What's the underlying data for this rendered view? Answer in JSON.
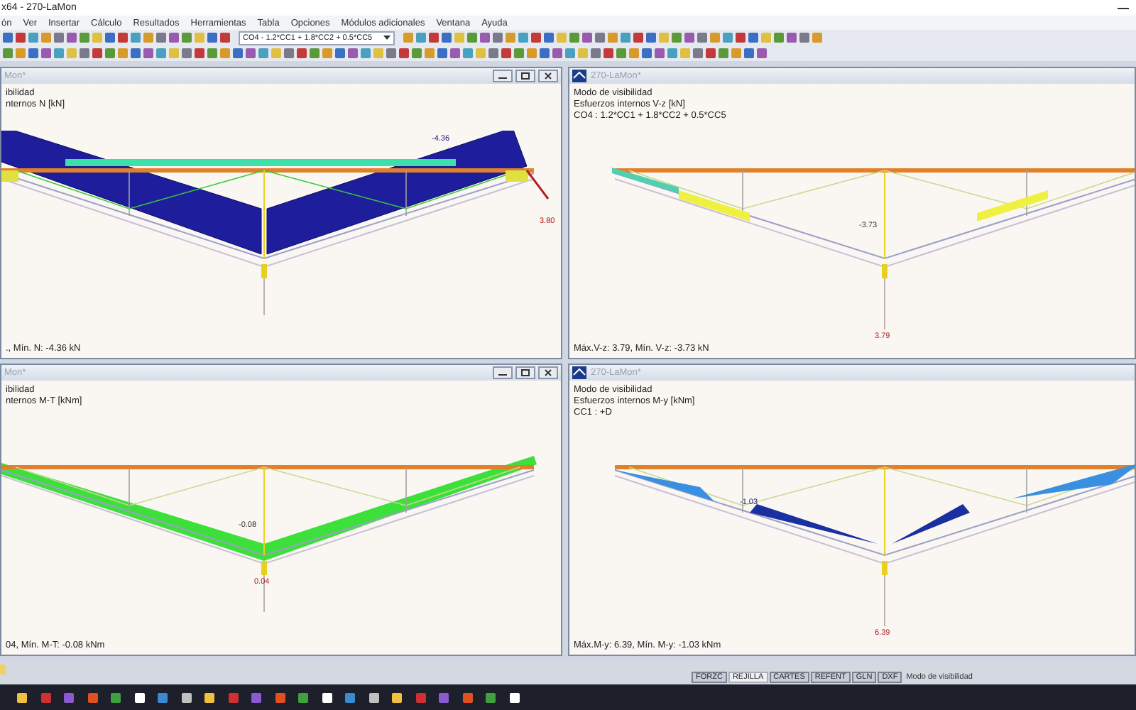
{
  "window": {
    "title": "x64 - 270-LaMon"
  },
  "menu": [
    "ón",
    "Ver",
    "Insertar",
    "Cálculo",
    "Resultados",
    "Herramientas",
    "Tabla",
    "Opciones",
    "Módulos adicionales",
    "Ventana",
    "Ayuda"
  ],
  "toolbar": {
    "load_combination": "CO4 - 1.2*CC1 + 1.8*CC2 + 0.5*CC5"
  },
  "panels": [
    {
      "title": "Mon*",
      "window_buttons": true,
      "app_icon": false,
      "kind": "axial",
      "info_lines": [
        "ibilidad",
        "nternos N [kN]"
      ],
      "labels": [
        "-4.36",
        "3.80"
      ],
      "summary": "., Mín. N: -4.36 kN"
    },
    {
      "title": "270-LaMon*",
      "window_buttons": false,
      "app_icon": true,
      "kind": "shear",
      "info_lines": [
        "Modo de visibilidad",
        "Esfuerzos internos V-z [kN]",
        "CO4 : 1.2*CC1 + 1.8*CC2 + 0.5*CC5"
      ],
      "labels": [
        "-3.73",
        "3.79"
      ],
      "summary": "Máx.V-z: 3.79, Mín. V-z: -3.73 kN"
    },
    {
      "title": "Mon*",
      "window_buttons": true,
      "app_icon": false,
      "kind": "torsion",
      "info_lines": [
        "ibilidad",
        "nternos M-T [kNm]"
      ],
      "labels": [
        "-0.08",
        "0.04"
      ],
      "summary": "04, Mín. M-T: -0.08 kNm"
    },
    {
      "title": "270-LaMon*",
      "window_buttons": false,
      "app_icon": true,
      "kind": "moment",
      "info_lines": [
        "Modo de visibilidad",
        "Esfuerzos internos M-y [kNm]",
        "CC1 : +D"
      ],
      "labels": [
        "-1.03",
        "6.39"
      ],
      "summary": "Máx.M-y: 6.39, Mín. M-y: -1.03 kNm"
    }
  ],
  "status_bar": {
    "toggles": [
      {
        "label": "FORZC",
        "selected": false
      },
      {
        "label": "REJILLA",
        "selected": true
      },
      {
        "label": "CARTES",
        "selected": false
      },
      {
        "label": "REFENT",
        "selected": false
      },
      {
        "label": "GLN",
        "selected": false
      },
      {
        "label": "DXF",
        "selected": false
      }
    ],
    "mode": "Modo de visibilidad"
  }
}
